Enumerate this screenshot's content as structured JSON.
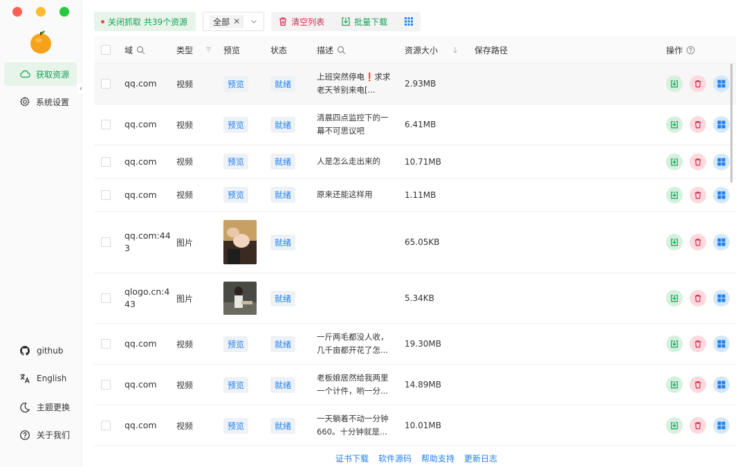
{
  "sidebar": {
    "nav": [
      {
        "label": "获取资源",
        "icon": "cloud-icon",
        "active": true
      },
      {
        "label": "系统设置",
        "icon": "gear-icon",
        "active": false
      }
    ],
    "bottom": [
      {
        "label": "github",
        "icon": "github-icon"
      },
      {
        "label": "English",
        "icon": "translate-icon"
      },
      {
        "label": "主题更换",
        "icon": "moon-icon"
      },
      {
        "label": "关于我们",
        "icon": "help-circle-icon"
      }
    ],
    "collapse_glyph": "‹"
  },
  "toolbar": {
    "capture_label": "关闭抓取 共39个资源",
    "filter_tag": "全部",
    "clear_label": "清空列表",
    "batch_label": "批量下载"
  },
  "table": {
    "headers": {
      "domain": "域",
      "type": "类型",
      "preview": "预览",
      "status": "状态",
      "desc": "描述",
      "size": "资源大小",
      "path": "保存路径",
      "actions": "操作"
    },
    "rows": [
      {
        "domain": "qq.com",
        "type": "视频",
        "preview": "预览",
        "status": "就绪",
        "desc": "上班突然停电❗️求求老天爷别来电[...",
        "size": "2.93MB"
      },
      {
        "domain": "qq.com",
        "type": "视频",
        "preview": "预览",
        "status": "就绪",
        "desc": "清晨四点监控下的一幕不可思议吧",
        "size": "6.41MB"
      },
      {
        "domain": "qq.com",
        "type": "视频",
        "preview": "预览",
        "status": "就绪",
        "desc": "人是怎么走出来的",
        "size": "10.71MB"
      },
      {
        "domain": "qq.com",
        "type": "视频",
        "preview": "预览",
        "status": "就绪",
        "desc": "原来还能这样用",
        "size": "1.11MB"
      },
      {
        "domain": "qq.com:443",
        "type": "图片",
        "preview": "",
        "status": "就绪",
        "desc": "",
        "size": "65.05KB"
      },
      {
        "domain": "qlogo.cn:443",
        "type": "图片",
        "preview": "",
        "status": "就绪",
        "desc": "",
        "size": "5.34KB"
      },
      {
        "domain": "qq.com",
        "type": "视频",
        "preview": "预览",
        "status": "就绪",
        "desc": "一斤两毛都没人收，几千亩都开花了怎...",
        "size": "19.30MB"
      },
      {
        "domain": "qq.com",
        "type": "视频",
        "preview": "预览",
        "status": "就绪",
        "desc": "老板娘居然给我两里一个计件，哟一分...",
        "size": "14.89MB"
      },
      {
        "domain": "qq.com",
        "type": "视频",
        "preview": "预览",
        "status": "就绪",
        "desc": "一天躺着不动一分钟660。十分钟就是...",
        "size": "10.01MB"
      }
    ]
  },
  "footer": {
    "links": [
      "证书下载",
      "软件源码",
      "帮助支持",
      "更新日志"
    ]
  },
  "colors": {
    "accent_green": "#18a058",
    "danger_red": "#d03050",
    "link_blue": "#2080f0"
  }
}
